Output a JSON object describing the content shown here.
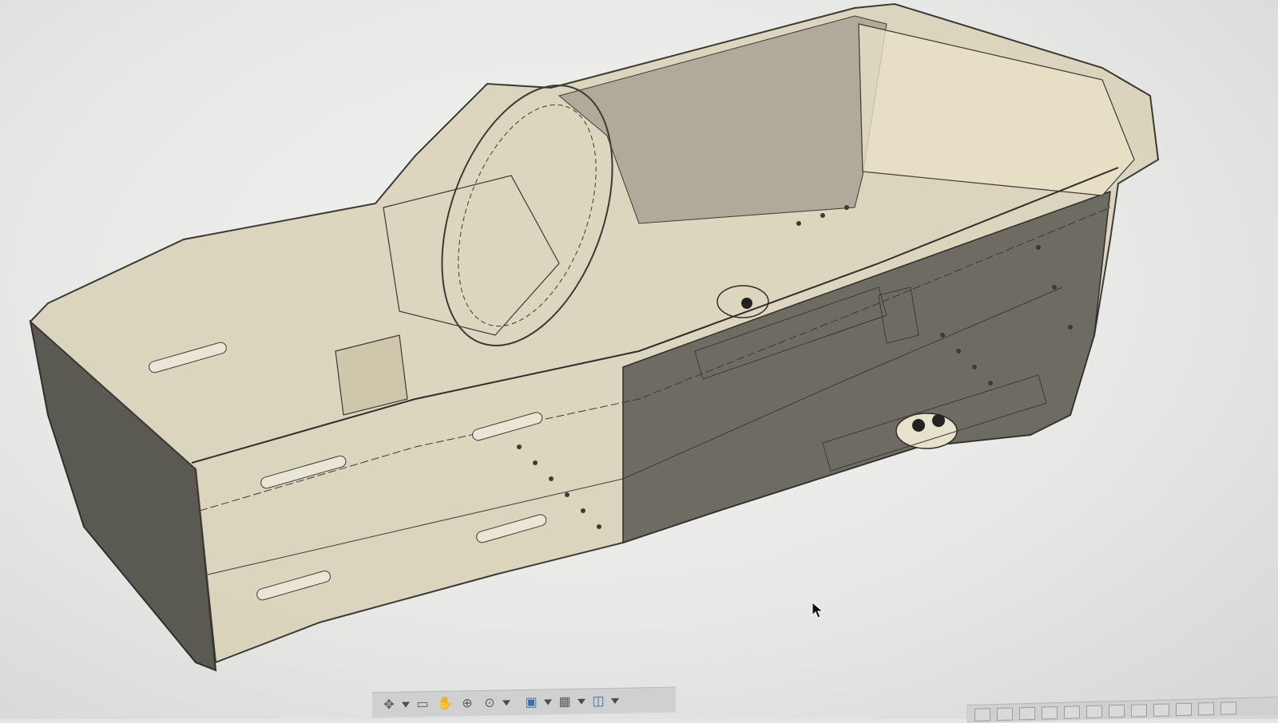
{
  "viewport": {
    "background": "#ececea",
    "model": "car-chassis-tub",
    "shell_color": "#d8cfb4",
    "shadow_color": "#55534c",
    "edge_color": "#3b3a35"
  },
  "nav_toolbar": {
    "tools": [
      {
        "name": "orbit-icon",
        "glyph": "✥"
      },
      {
        "name": "look-at-icon",
        "glyph": "▭"
      },
      {
        "name": "pan-icon",
        "glyph": "✋"
      },
      {
        "name": "zoom-icon",
        "glyph": "⊕"
      },
      {
        "name": "fit-zoom-icon",
        "glyph": "⊙"
      }
    ],
    "display": [
      {
        "name": "display-settings-icon",
        "glyph": "▣"
      },
      {
        "name": "grid-settings-icon",
        "glyph": "▦"
      },
      {
        "name": "viewports-icon",
        "glyph": "◫"
      }
    ]
  }
}
